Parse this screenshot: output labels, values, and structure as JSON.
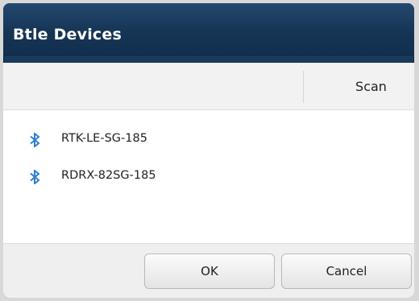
{
  "dialog": {
    "title": "Btle Devices"
  },
  "toolbar": {
    "scan_label": "Scan"
  },
  "devices": [
    {
      "name": "RTK-LE-SG-185",
      "icon": "bluetooth-icon"
    },
    {
      "name": "RDRX-82SG-185",
      "icon": "bluetooth-icon"
    }
  ],
  "footer": {
    "ok_label": "OK",
    "cancel_label": "Cancel"
  },
  "colors": {
    "titlebar": "#163556",
    "bluetooth": "#2f7fd0"
  }
}
